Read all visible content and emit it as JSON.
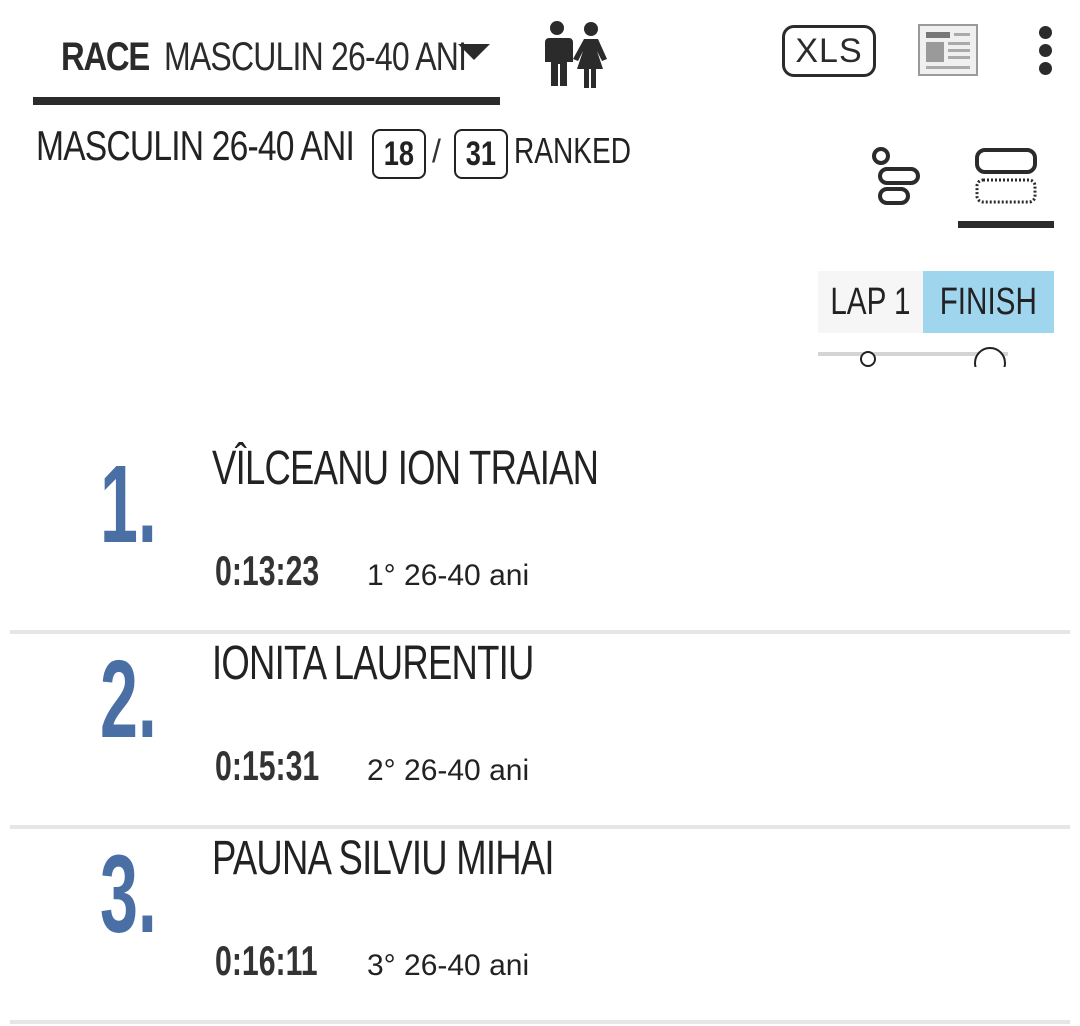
{
  "header": {
    "race_label": "RACE",
    "race_value": "MASCULIN 26-40 ANI",
    "xls_label": "XLS"
  },
  "category": {
    "title": "MASCULIN 26-40 ANI",
    "shown": "18",
    "total": "31",
    "separator": "/",
    "ranked_label": "RANKED"
  },
  "laps": {
    "tabs": [
      {
        "label": "LAP 1"
      },
      {
        "label": "FINISH"
      }
    ],
    "active": "FINISH"
  },
  "colors": {
    "rank": "#4a6fa5",
    "active_tab": "#9fd6ee",
    "dark": "#2b2b2b"
  },
  "results": [
    {
      "rank": "1.",
      "name": "VÎLCEANU ION TRAIAN",
      "time": "0:13:23",
      "class": "1° 26-40 ani"
    },
    {
      "rank": "2.",
      "name": "IONITA LAURENTIU",
      "time": "0:15:31",
      "class": "2° 26-40 ani"
    },
    {
      "rank": "3.",
      "name": "PAUNA SILVIU MIHAI",
      "time": "0:16:11",
      "class": "3° 26-40 ani"
    }
  ],
  "icons": [
    "caret-down-icon",
    "gender-icon",
    "xls-icon",
    "newspaper-icon",
    "more-vert-icon",
    "tree-view-icon",
    "card-view-icon"
  ]
}
